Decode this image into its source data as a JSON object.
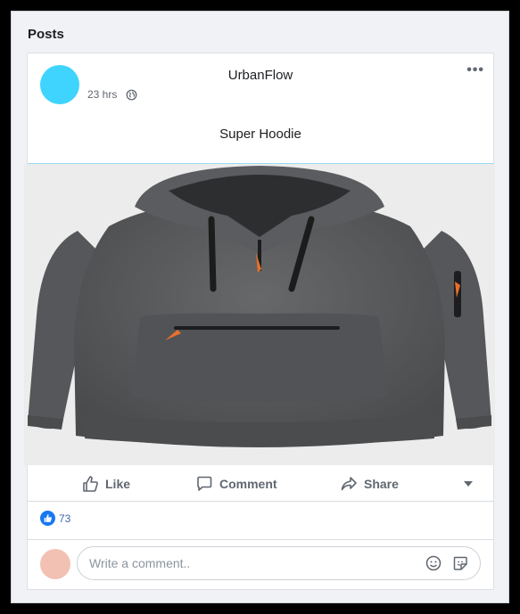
{
  "section": {
    "title": "Posts"
  },
  "post": {
    "author": "UrbanFlow",
    "time": "23 hrs",
    "audience_icon": "globe-icon",
    "text": "Super Hoodie",
    "image_subject": "hoodie-photo"
  },
  "actions": {
    "like": "Like",
    "comment": "Comment",
    "share": "Share"
  },
  "reactions": {
    "count": "73"
  },
  "comment_box": {
    "placeholder": "Write a comment.."
  },
  "colors": {
    "avatar": "#3fd4fd",
    "like_blue": "#1877f2",
    "commenter_avatar": "#f3c1b4",
    "hoodie": "#58595b"
  }
}
